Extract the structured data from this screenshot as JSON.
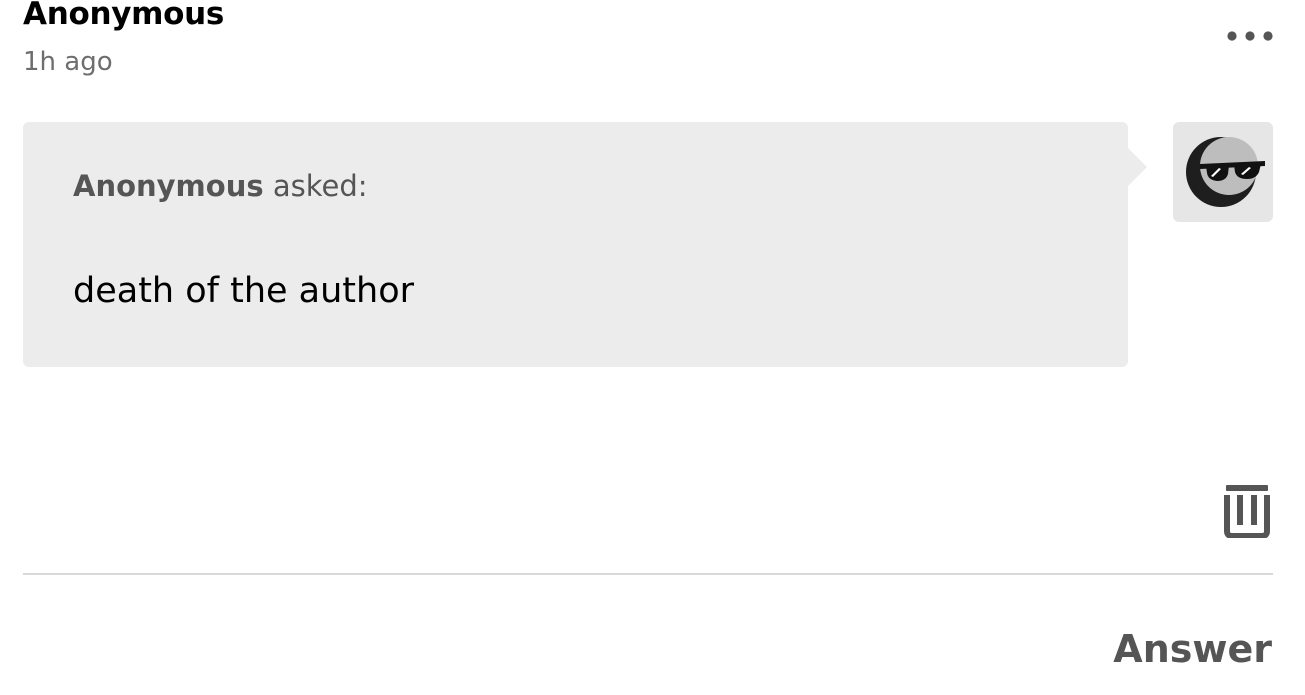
{
  "post": {
    "author": "Anonymous",
    "timestamp": "1h ago",
    "more_icon": "ellipsis-horizontal-icon"
  },
  "ask": {
    "asker_name": "Anonymous",
    "asked_suffix": " asked:",
    "question": "death of the author",
    "avatar": "anonymous-sunglasses-avatar"
  },
  "actions": {
    "delete_icon": "trash-icon",
    "answer_label": "Answer"
  },
  "colors": {
    "bubble_background": "#ececec",
    "muted_text": "#6e6e6e",
    "asker_text": "#555555",
    "divider": "#d8d8d8"
  }
}
